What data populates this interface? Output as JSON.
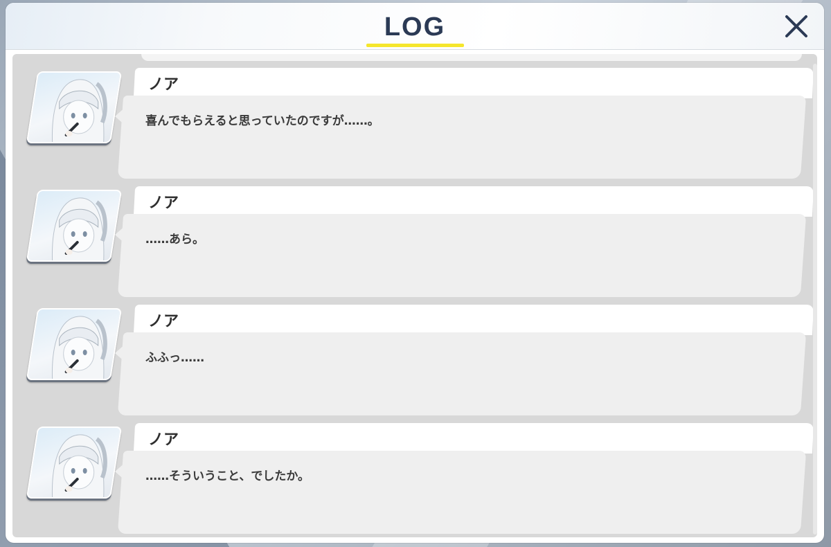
{
  "header": {
    "title": "LOG",
    "accent_color": "#f5e62c",
    "close_icon": "close-icon"
  },
  "entries": [
    {
      "speaker": "ノア",
      "text": "喜んでもらえると思っていたのですが……。",
      "avatar": "character-portrait"
    },
    {
      "speaker": "ノア",
      "text": "……あら。",
      "avatar": "character-portrait"
    },
    {
      "speaker": "ノア",
      "text": "ふふっ……",
      "avatar": "character-portrait"
    },
    {
      "speaker": "ノア",
      "text": "……そういうこと、でしたか。",
      "avatar": "character-portrait"
    }
  ]
}
